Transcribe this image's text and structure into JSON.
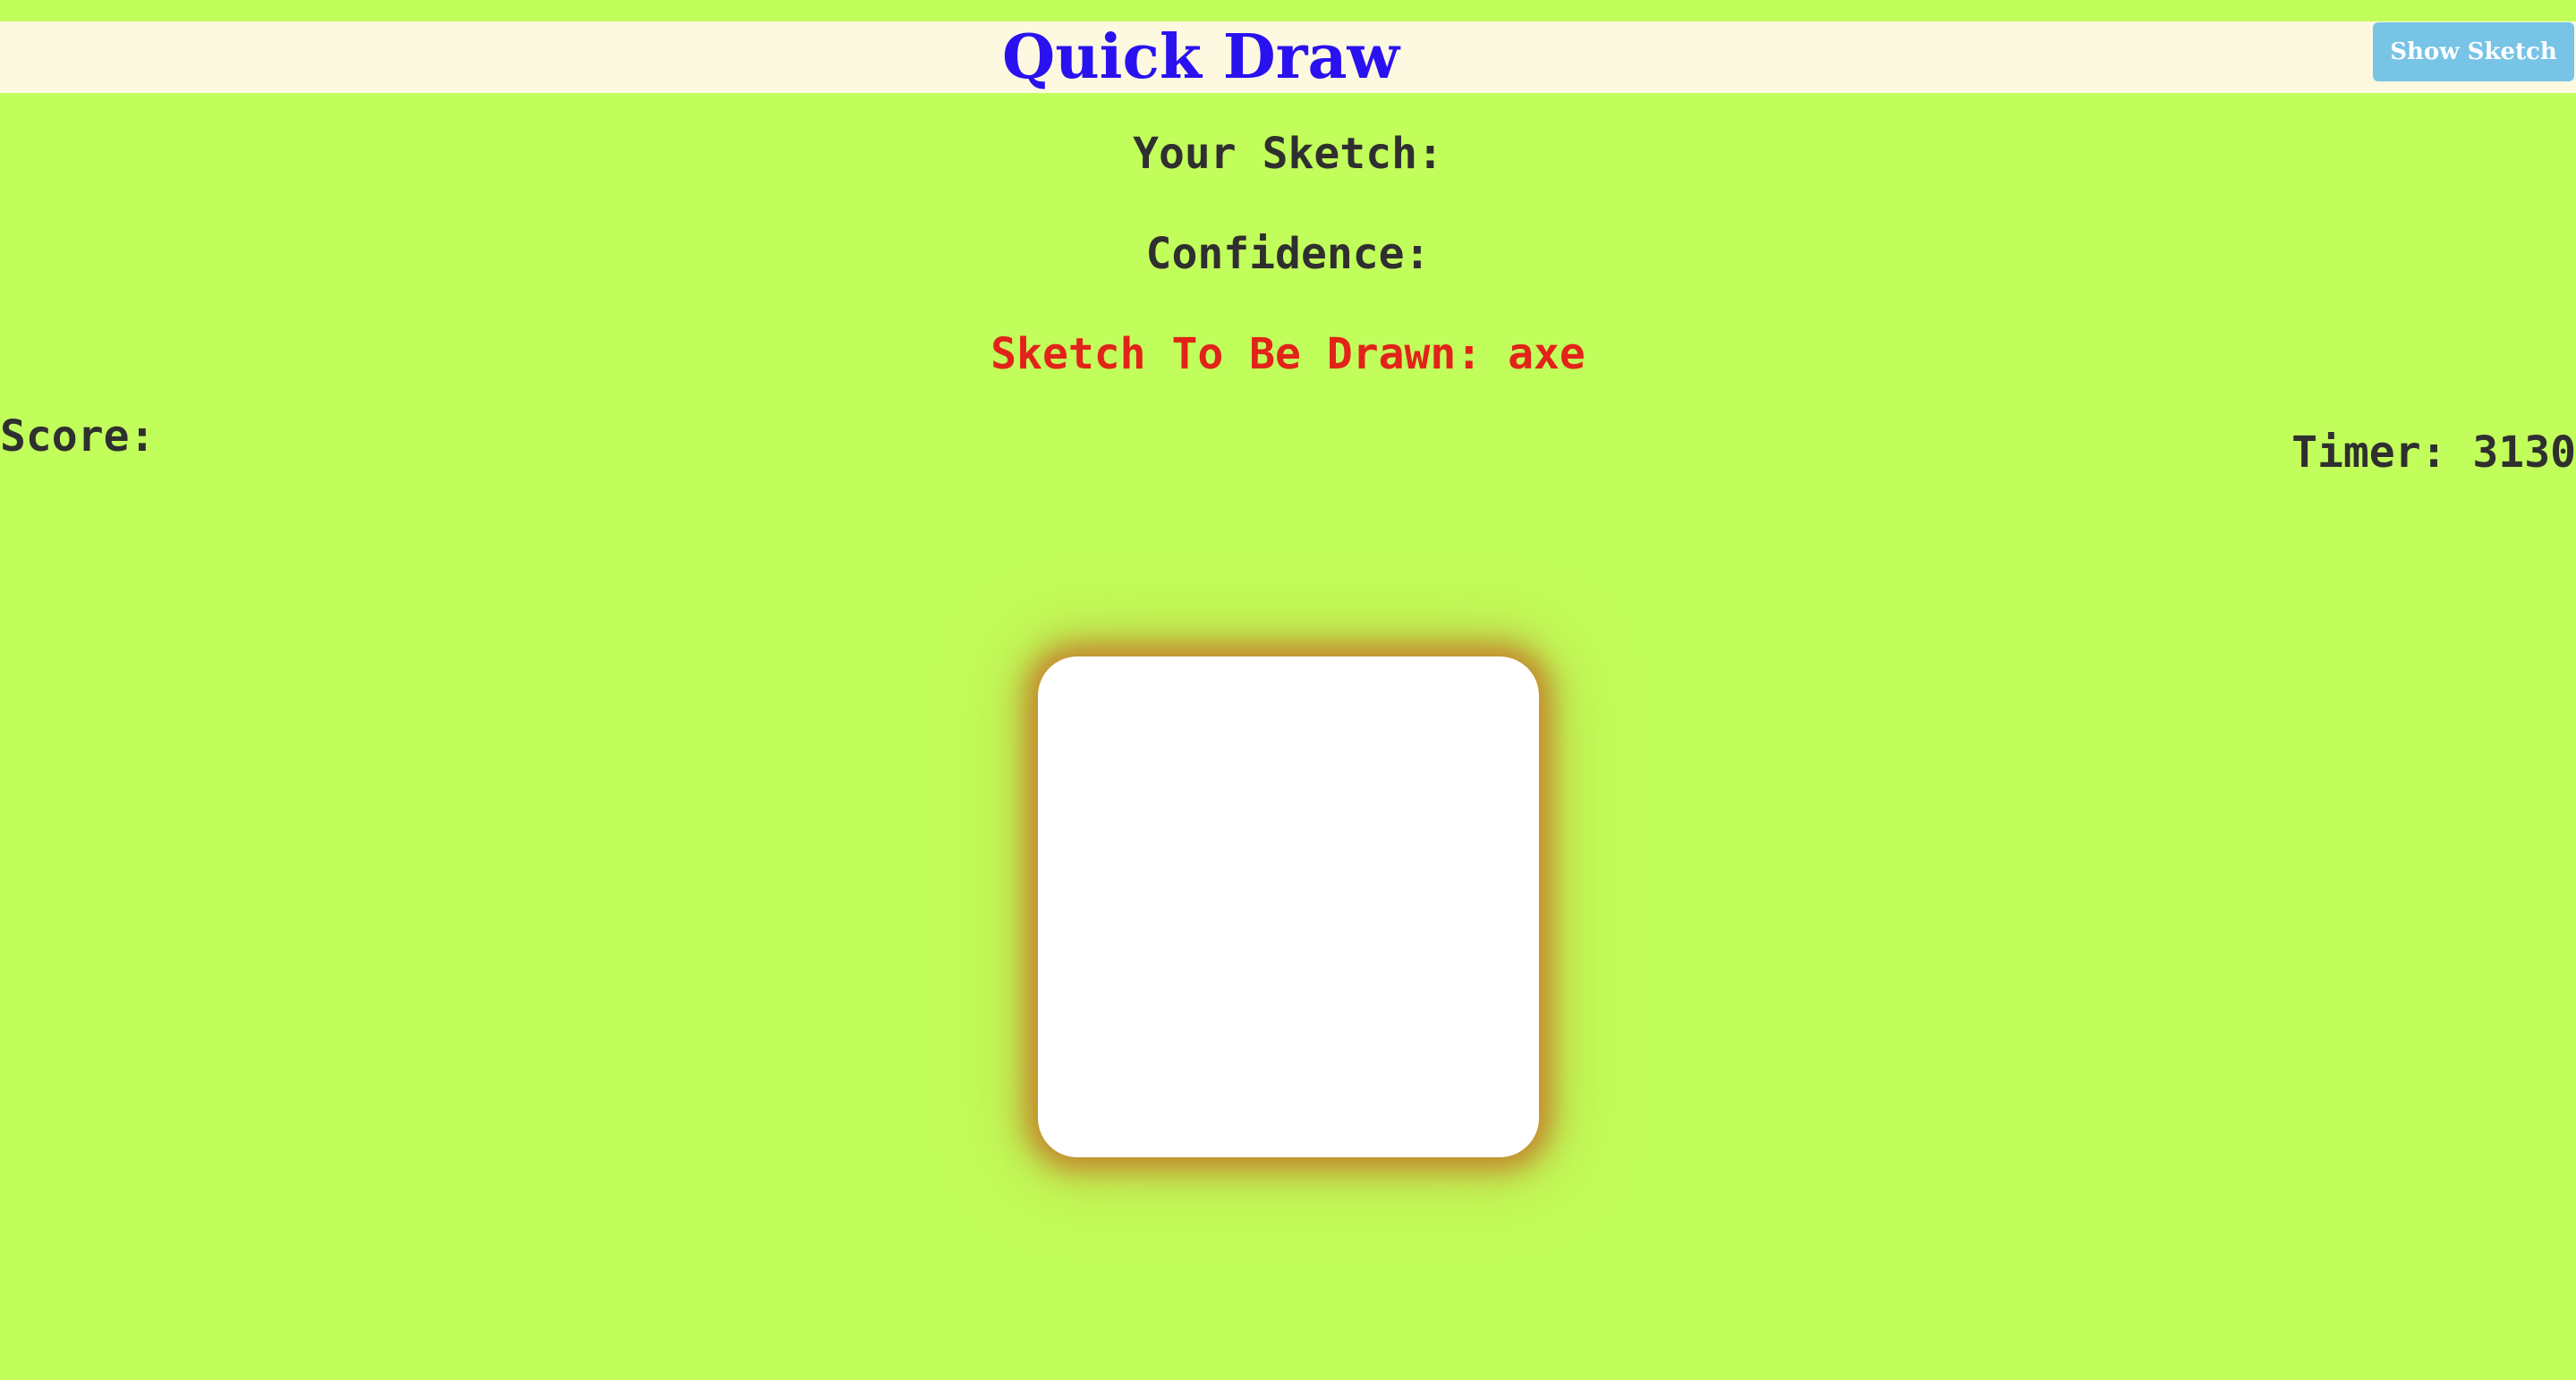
{
  "header": {
    "title": "Quick Draw",
    "show_sketch_label": "Show Sketch"
  },
  "status": {
    "your_sketch": "Your Sketch:",
    "confidence": "Confidence:",
    "target": "Sketch To Be Drawn: axe",
    "score": "Score:",
    "timer": "Timer: 3130"
  },
  "colors": {
    "background": "#c2fe5b",
    "header_bar": "#fdf8e0",
    "title": "#2a12f0",
    "target_text": "#e2231a",
    "button": "#77c4e6",
    "text": "#2f2f2f",
    "canvas": "#ffffff"
  }
}
